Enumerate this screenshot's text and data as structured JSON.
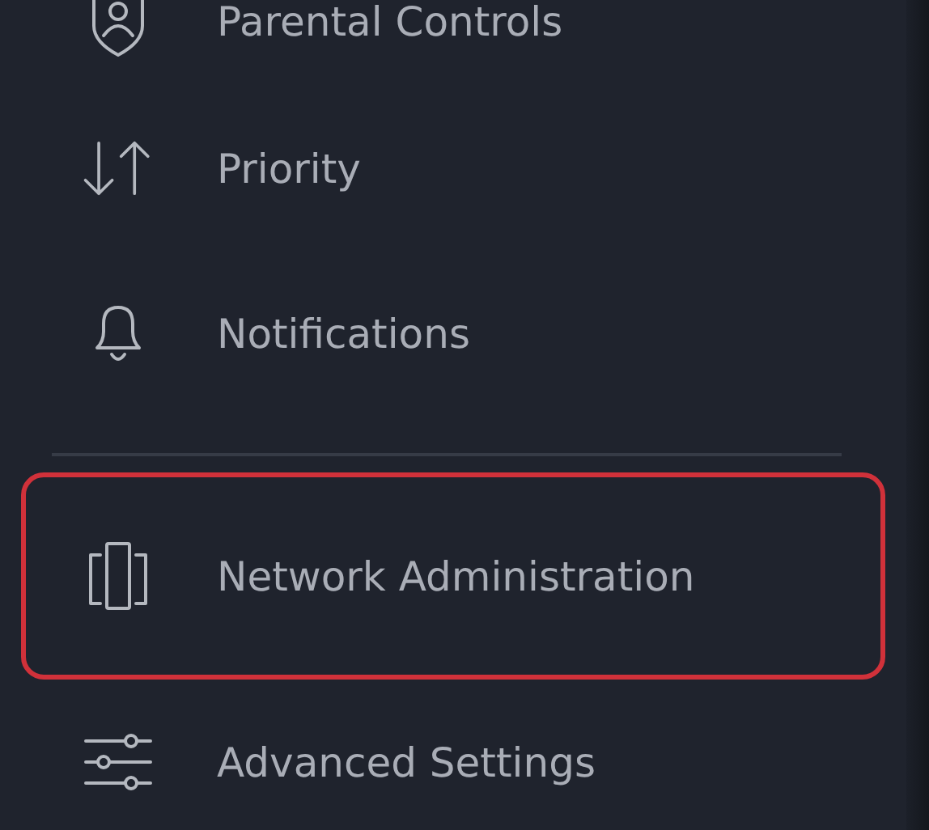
{
  "menu": {
    "groups": [
      [
        {
          "label": "Parental Controls",
          "kind": "shield",
          "selected": false
        },
        {
          "label": "Priority",
          "kind": "arrows",
          "selected": false
        },
        {
          "label": "Notifications",
          "kind": "bell",
          "selected": false
        }
      ],
      [
        {
          "label": "Network Administration",
          "kind": "nodes",
          "selected": true
        },
        {
          "label": "Advanced Settings",
          "kind": "sliders",
          "selected": false
        }
      ]
    ]
  }
}
